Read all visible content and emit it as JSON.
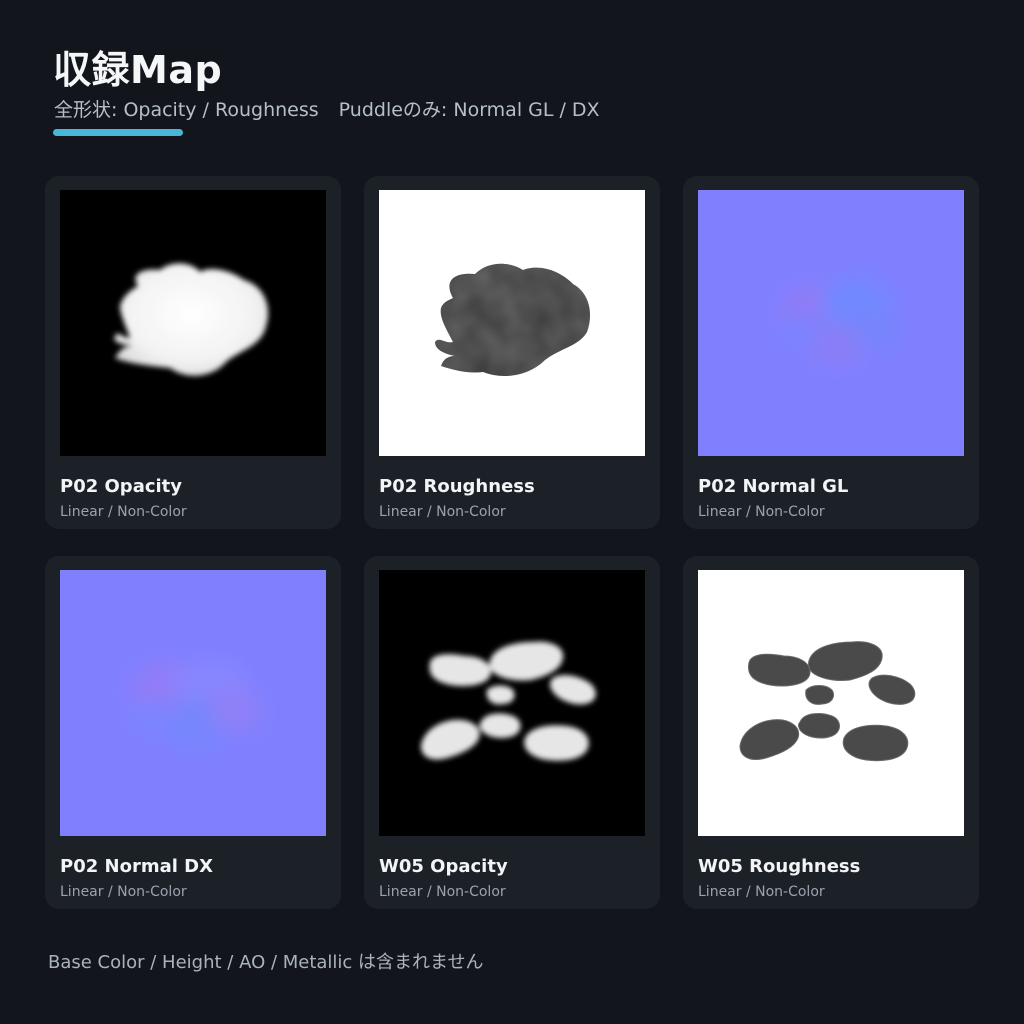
{
  "header": {
    "title": "収録Map",
    "subtitle_all_shapes": "全形状: Opacity / Roughness",
    "subtitle_puddle_only": "Puddleのみ: Normal GL / DX",
    "accent_color": "#49b6d8"
  },
  "maps": [
    {
      "title": "P02 Opacity",
      "subtitle": "Linear / Non-Color",
      "thumbnail": "p02-opacity-map",
      "background": "#000000"
    },
    {
      "title": "P02 Roughness",
      "subtitle": "Linear / Non-Color",
      "thumbnail": "p02-roughness-map",
      "background": "#ffffff"
    },
    {
      "title": "P02 Normal GL",
      "subtitle": "Linear / Non-Color",
      "thumbnail": "p02-normal-gl-map",
      "background": "#8080ff"
    },
    {
      "title": "P02 Normal DX",
      "subtitle": "Linear / Non-Color",
      "thumbnail": "p02-normal-dx-map",
      "background": "#8080ff"
    },
    {
      "title": "W05 Opacity",
      "subtitle": "Linear / Non-Color",
      "thumbnail": "w05-opacity-map",
      "background": "#000000"
    },
    {
      "title": "W05 Roughness",
      "subtitle": "Linear / Non-Color",
      "thumbnail": "w05-roughness-map",
      "background": "#ffffff"
    }
  ],
  "footnote": "Base Color / Height / AO / Metallic は含まれません"
}
